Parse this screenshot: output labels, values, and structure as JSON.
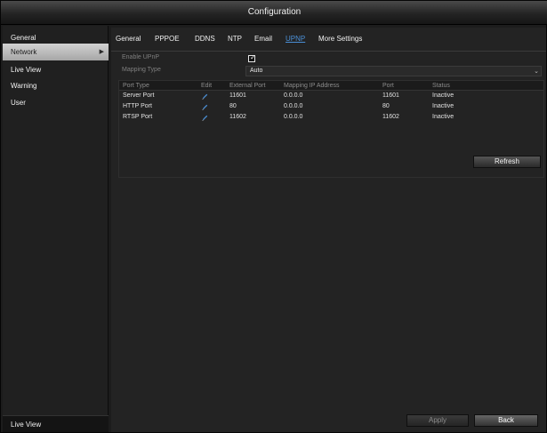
{
  "window": {
    "title": "Configuration"
  },
  "sidebar": {
    "items": [
      {
        "label": "General"
      },
      {
        "label": "Network",
        "arrow": "▶"
      },
      {
        "label": "Live View"
      },
      {
        "label": "Warning"
      },
      {
        "label": "User"
      }
    ],
    "bottom_label": "Live View"
  },
  "tabs": [
    "General",
    "PPPOE",
    "DDNS",
    "NTP",
    "Email",
    "UPNP",
    "More Settings"
  ],
  "active_tab": "UPNP",
  "form": {
    "enable_label": "Enable UPnP",
    "enable_checked": true,
    "mapping_type_label": "Mapping Type",
    "mapping_type_value": "Auto"
  },
  "table": {
    "headers": [
      "Port Type",
      "Edit",
      "External Port",
      "Mapping IP Address",
      "Port",
      "Status"
    ],
    "rows": [
      [
        "Server Port",
        "",
        "11601",
        "0.0.0.0",
        "11601",
        "Inactive"
      ],
      [
        "HTTP Port",
        "",
        "80",
        "0.0.0.0",
        "80",
        "Inactive"
      ],
      [
        "RTSP Port",
        "",
        "11602",
        "0.0.0.0",
        "11602",
        "Inactive"
      ]
    ]
  },
  "buttons": {
    "refresh": "Refresh",
    "apply": "Apply",
    "back": "Back"
  },
  "icons": {
    "edit": "pencil-icon",
    "caret": "dropdown-caret-icon"
  },
  "colors": {
    "accent": "#4a8fd6",
    "active_sidebar": "#c8c8c8",
    "background": "#232323"
  }
}
